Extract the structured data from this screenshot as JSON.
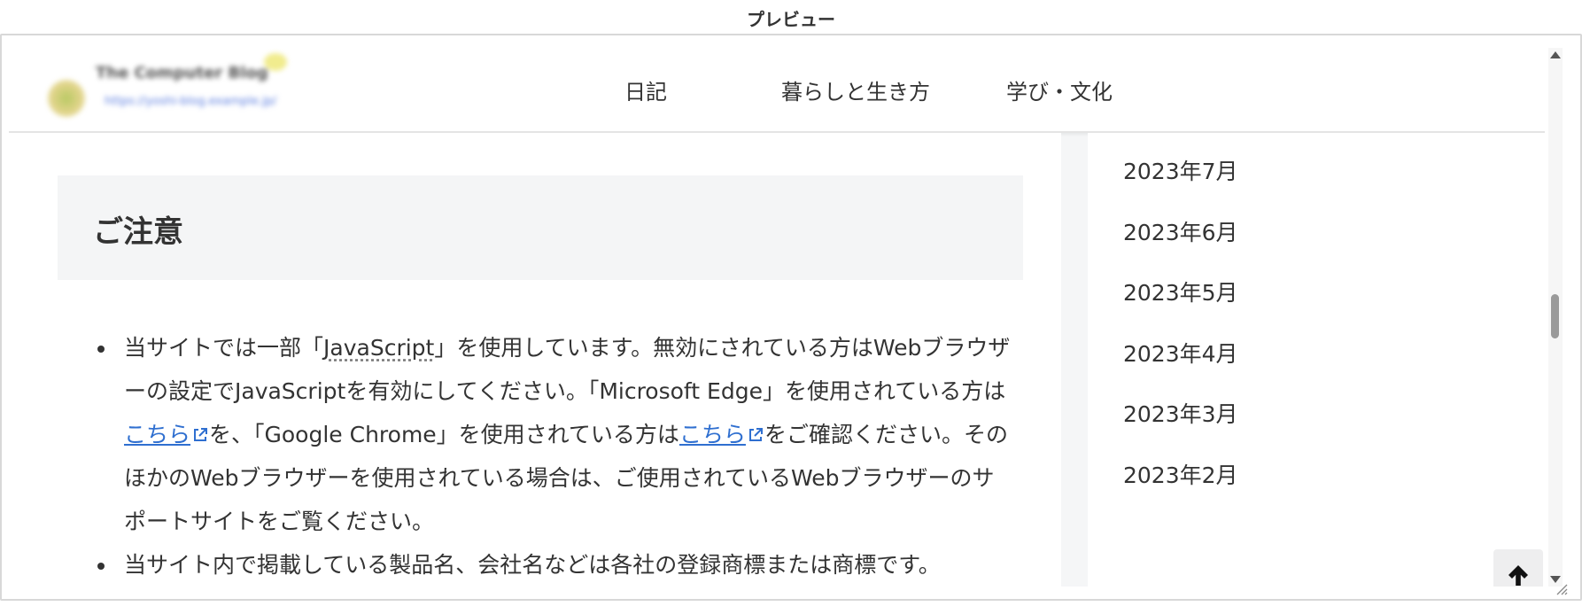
{
  "preview_label": "プレビュー",
  "site": {
    "name": "The Computer Blog",
    "url": "https://yoshi-blog.example.jp/"
  },
  "nav": {
    "items": [
      {
        "label": "日記"
      },
      {
        "label": "暮らしと生き方"
      },
      {
        "label": "学び・文化"
      }
    ]
  },
  "notice": {
    "heading": "ご注意",
    "item1": {
      "t1": "当サイトでは一部「",
      "abbr": "JavaScript",
      "t2": "」を使用しています。無効にされている方はWebブラウザーの設定でJavaScriptを有効にしてください。「Microsoft Edge」を使用されている方は",
      "link1": "こちら",
      "t3": "を、「Google Chrome」を使用されている方は",
      "link2": "こちら",
      "t4": "をご確認ください。そのほかのWebブラウザーを使用されている場合は、ご使用されているWebブラウザーのサポートサイトをご覧ください。"
    },
    "item2": "当サイト内で掲載している製品名、会社名などは各社の登録商標または商標です。"
  },
  "sidebar": {
    "archives": [
      {
        "label": "2023年7月"
      },
      {
        "label": "2023年6月"
      },
      {
        "label": "2023年5月"
      },
      {
        "label": "2023年4月"
      },
      {
        "label": "2023年3月"
      },
      {
        "label": "2023年2月"
      }
    ]
  },
  "icons": {
    "external_link": "external-link-icon",
    "back_to_top": "arrow-up-icon"
  },
  "colors": {
    "link": "#2f6fd0",
    "heading_box": "#f4f5f6",
    "text": "#333333"
  }
}
